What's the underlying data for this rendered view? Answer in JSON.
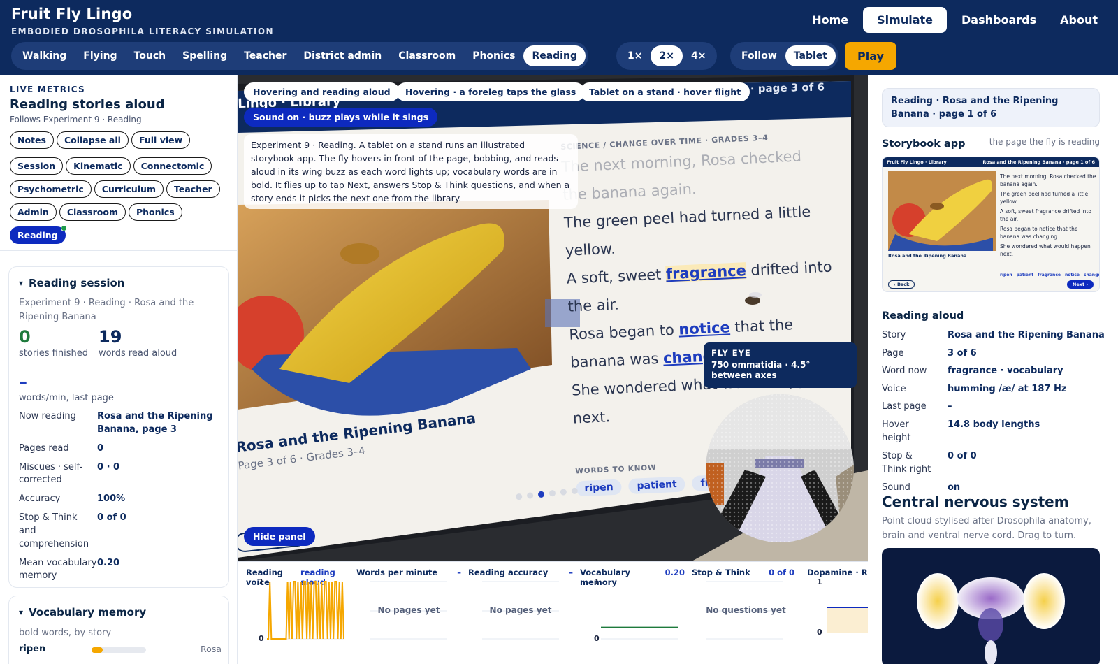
{
  "header": {
    "title": "Fruit Fly Lingo",
    "subtitle": "EMBODIED DROSOPHILA LITERACY SIMULATION",
    "nav": [
      "Home",
      "Simulate",
      "Dashboards",
      "About"
    ],
    "nav_active": "Simulate",
    "scenarios": [
      "Walking",
      "Flying",
      "Touch",
      "Spelling",
      "Teacher",
      "District admin",
      "Classroom",
      "Phonics",
      "Reading"
    ],
    "scenario_active": "Reading",
    "speeds": [
      "1×",
      "2×",
      "4×"
    ],
    "speed_active": "2×",
    "camera": [
      "Follow",
      "Tablet"
    ],
    "camera_active": "Tablet",
    "play_label": "Play"
  },
  "left": {
    "kicker": "LIVE METRICS",
    "title": "Reading stories aloud",
    "follows": "Follows Experiment 9 · Reading",
    "actions": [
      "Notes",
      "Collapse all",
      "Full view"
    ],
    "filters": [
      "Session",
      "Kinematic",
      "Connectomic",
      "Psychometric",
      "Curriculum",
      "Teacher",
      "Admin",
      "Classroom",
      "Phonics",
      "Reading"
    ],
    "filter_active": "Reading",
    "session": {
      "heading": "Reading session",
      "caption": "Experiment 9 · Reading · Rosa and the Ripening Banana",
      "stories_finished": "0",
      "stories_label": "stories finished",
      "words_read": "19",
      "words_label": "words read aloud",
      "wpm": "–",
      "wpm_label": "words/min, last page",
      "rows": [
        {
          "k": "Now reading",
          "v": "Rosa and the Ripening Banana, page 3"
        },
        {
          "k": "Pages read",
          "v": "0"
        },
        {
          "k": "Miscues · self-corrected",
          "v": "0 · 0"
        },
        {
          "k": "Accuracy",
          "v": "100%"
        },
        {
          "k": "Stop & Think and comprehension",
          "v": "0 of 0"
        },
        {
          "k": "Mean vocabulary memory",
          "v": "0.20"
        }
      ]
    },
    "vocab": {
      "heading": "Vocabulary memory",
      "caption": "bold words, by story",
      "items": [
        {
          "word": "ripen",
          "level": 0.2,
          "story": "Rosa"
        }
      ]
    }
  },
  "stage": {
    "labels": [
      "Hovering and reading aloud",
      "Hovering · a foreleg taps the glass",
      "Tablet on a stand · hover flight"
    ],
    "sound": "Sound on · buzz plays while it sings",
    "description": "Experiment 9 · Reading. A tablet on a stand runs an illustrated storybook app. The fly hovers in front of the page, bobbing, and reads aloud in its wing buzz as each word lights up; vocabulary words are in bold. It flies up to tap Next, answers Stop & Think questions, and when a story ends it picks the next one from the library.",
    "screen_header_left": "Lingo · Library",
    "screen_header_right": "Rosa and the Ripening Banana · page 3 of 6",
    "kicker": "SCIENCE / CHANGE OVER TIME · GRADES 3–4",
    "story_lines": [
      [
        {
          "t": "The next morning, Rosa checked"
        }
      ],
      [
        {
          "t": "the banana again."
        }
      ],
      [
        {
          "t": "The green peel had turned a little"
        }
      ],
      [
        {
          "t": "yellow."
        }
      ],
      [
        {
          "t": "A soft, sweet "
        },
        {
          "t": "fragrance",
          "b": 1
        },
        {
          "t": " drifted into"
        }
      ],
      [
        {
          "t": "the air."
        }
      ],
      [
        {
          "t": "Rosa began to "
        },
        {
          "t": "notice",
          "b": 1
        },
        {
          "t": " that the"
        }
      ],
      [
        {
          "t": "banana was "
        },
        {
          "t": "changing",
          "b": 1
        },
        {
          "t": "."
        }
      ],
      [
        {
          "t": "She wondered what would happen"
        }
      ],
      [
        {
          "t": "next."
        }
      ]
    ],
    "story_title": "Rosa and the Ripening Banana",
    "story_sub": "Page 3 of 6 · Grades 3–4",
    "words_to_know_label": "WORDS TO KNOW",
    "words_to_know": [
      "ripen",
      "patient",
      "fragrance"
    ],
    "back_label": "‹ Back",
    "hide_panel": "Hide panel",
    "fly_eye_title": "FLY EYE",
    "fly_eye_desc": "750 ommatidia · 4.5° between axes"
  },
  "charts": [
    {
      "title": "Reading voice",
      "value": "reading aloud",
      "ymax": "1",
      "ymin": "0"
    },
    {
      "title": "Words per minute",
      "value": "–",
      "empty": "No pages yet"
    },
    {
      "title": "Reading accuracy",
      "value": "–",
      "empty": "No pages yet"
    },
    {
      "title": "Vocabulary memory",
      "value": "0.20",
      "ymax": "1",
      "ymin": "0"
    },
    {
      "title": "Stop & Think",
      "value": "0 of 0",
      "empty": "No questions yet"
    },
    {
      "title": "Dopamine · R",
      "ymax": "1",
      "ymin": "0"
    }
  ],
  "chart_data": [
    {
      "type": "line",
      "title": "Reading voice",
      "ylim": [
        0,
        1
      ],
      "series": [
        {
          "values": [
            0,
            0,
            1,
            0,
            0,
            0,
            0,
            0,
            0,
            0,
            0,
            0,
            0,
            0,
            1,
            0,
            1,
            0,
            1,
            1,
            0,
            1,
            0,
            1,
            0,
            1,
            1,
            0,
            1,
            0,
            1,
            0,
            1,
            1,
            0,
            1,
            0,
            1,
            0,
            1,
            1,
            0,
            1,
            0,
            1,
            0,
            1,
            1,
            0,
            1,
            0,
            1,
            0
          ]
        }
      ]
    },
    {
      "type": "line",
      "title": "Vocabulary memory",
      "ylim": [
        0,
        1
      ],
      "series": [
        {
          "values": [
            0.2,
            0.2
          ]
        }
      ]
    },
    {
      "type": "area",
      "title": "Dopamine · R",
      "ylim": [
        0,
        1
      ],
      "series": [
        {
          "values": [
            0.5,
            0.5
          ]
        }
      ]
    }
  ],
  "right": {
    "current": "Reading · Rosa and the Ripening Banana · page 1 of 6",
    "app_title": "Storybook app",
    "app_note": "the page the fly is reading",
    "thumb": {
      "hdr_left": "Fruit Fly Lingo · Library",
      "hdr_right": "Rosa and the Ripening Banana · page 1 of 6",
      "lines": [
        "The next morning, Rosa checked the banana again.",
        "The green peel had turned a little yellow.",
        "A soft, sweet fragrance drifted into the air.",
        "Rosa began to notice that the banana was changing.",
        "She wondered what would happen next."
      ],
      "caption": "Rosa and the Ripening Banana",
      "words": [
        "ripen",
        "patient",
        "fragrance",
        "notice",
        "change"
      ],
      "back": "‹ Back",
      "next": "Next ›"
    },
    "reading_heading": "Reading aloud",
    "rows": [
      {
        "k": "Story",
        "v": "Rosa and the Ripening Banana"
      },
      {
        "k": "Page",
        "v": "3 of 6"
      },
      {
        "k": "Word now",
        "v": "fragrance · vocabulary"
      },
      {
        "k": "Voice",
        "v": "humming /æ/ at 187 Hz"
      },
      {
        "k": "Last page",
        "v": "–"
      },
      {
        "k": "Hover height",
        "v": "14.8 body lengths"
      },
      {
        "k": "Stop & Think right",
        "v": "0 of 0"
      },
      {
        "k": "Sound",
        "v": "on"
      }
    ],
    "cns_title": "Central nervous system",
    "cns_desc": "Point cloud stylised after Drosophila anatomy, brain and ventral nerve cord. Drag to turn."
  },
  "colors": {
    "navy": "#0d2a5e",
    "accent": "#f5a700",
    "link": "#1e3dbf",
    "green": "#1e7a3c"
  }
}
